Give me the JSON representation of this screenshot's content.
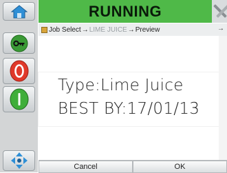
{
  "header": {
    "status": "RUNNING"
  },
  "breadcrumb": {
    "items": [
      "Job Select",
      "LIME JUICE",
      "Preview"
    ],
    "separator": "→",
    "more": "→"
  },
  "preview": {
    "line1": "Type:Lime Juice",
    "line2": "BEST BY:17/01/13"
  },
  "footer": {
    "cancel_label": "Cancel",
    "ok_label": "OK"
  },
  "sidebar": {
    "icons": [
      "home-icon",
      "key-icon",
      "stop-icon",
      "start-icon",
      "navigate-icon"
    ]
  },
  "colors": {
    "running": "#4fb948",
    "stop": "#e0392a",
    "start": "#3fae3a",
    "key": "#3b9a36",
    "nav": "#2f8fd6"
  }
}
